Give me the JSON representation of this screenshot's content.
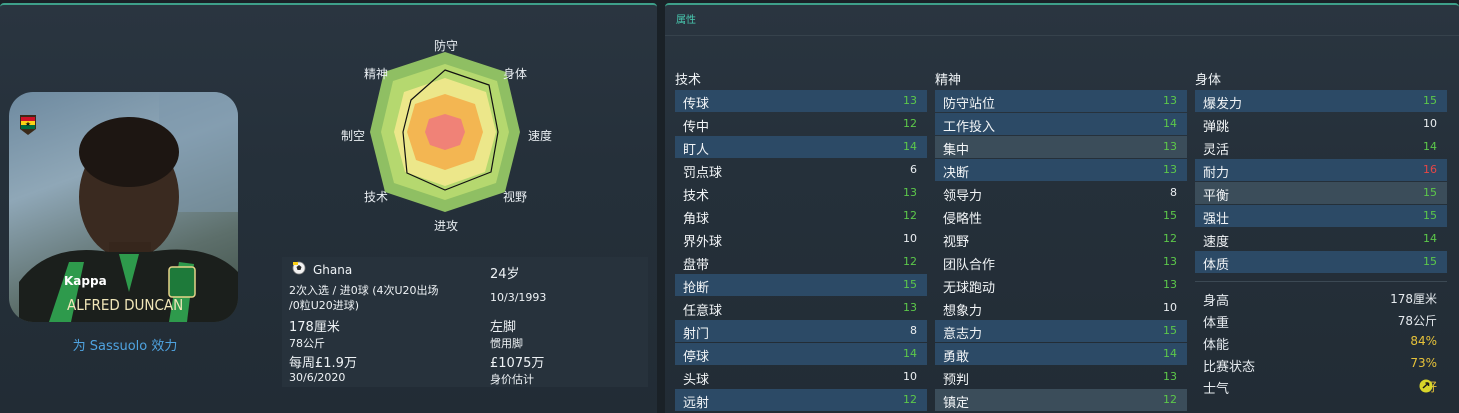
{
  "left": {
    "club_line": "为 Sassuolo 效力",
    "portrait_caption": "ALFRED DUNCAN",
    "kit_sponsor": "Kappa",
    "radar_labels": [
      "防守",
      "身体",
      "速度",
      "视野",
      "进攻",
      "技术",
      "制空",
      "精神"
    ],
    "nation": "Ghana",
    "caps": "2次入选 / 进0球 (4次U20出场",
    "caps2": "/0粒U20进球)",
    "age": "24岁",
    "dob": "10/3/1993",
    "height": "178厘米",
    "weight": "78公斤",
    "foot": "左脚",
    "foot_label": "惯用脚",
    "wage": "每周£1.9万",
    "contract": "30/6/2020",
    "value": "£1075万",
    "value_label": "身价估计"
  },
  "right": {
    "tab_title": "属性",
    "tech_title": "技术",
    "mental_title": "精神",
    "phys_title": "身体",
    "technical": [
      {
        "name": "传球",
        "value": "13"
      },
      {
        "name": "传中",
        "value": "12"
      },
      {
        "name": "盯人",
        "value": "14"
      },
      {
        "name": "罚点球",
        "value": "6"
      },
      {
        "name": "技术",
        "value": "13"
      },
      {
        "name": "角球",
        "value": "12"
      },
      {
        "name": "界外球",
        "value": "10"
      },
      {
        "name": "盘带",
        "value": "12"
      },
      {
        "name": "抢断",
        "value": "15"
      },
      {
        "name": "任意球",
        "value": "13"
      },
      {
        "name": "射门",
        "value": "8"
      },
      {
        "name": "停球",
        "value": "14"
      },
      {
        "name": "头球",
        "value": "10"
      },
      {
        "name": "远射",
        "value": "12"
      }
    ],
    "mental": [
      {
        "name": "防守站位",
        "value": "13"
      },
      {
        "name": "工作投入",
        "value": "14"
      },
      {
        "name": "集中",
        "value": "13"
      },
      {
        "name": "决断",
        "value": "13"
      },
      {
        "name": "领导力",
        "value": "8"
      },
      {
        "name": "侵略性",
        "value": "15"
      },
      {
        "name": "视野",
        "value": "12"
      },
      {
        "name": "团队合作",
        "value": "13"
      },
      {
        "name": "无球跑动",
        "value": "13"
      },
      {
        "name": "想象力",
        "value": "10"
      },
      {
        "name": "意志力",
        "value": "15"
      },
      {
        "name": "勇敢",
        "value": "14"
      },
      {
        "name": "预判",
        "value": "13"
      },
      {
        "name": "镇定",
        "value": "12"
      }
    ],
    "physical": [
      {
        "name": "爆发力",
        "value": "15"
      },
      {
        "name": "弹跳",
        "value": "10"
      },
      {
        "name": "灵活",
        "value": "14"
      },
      {
        "name": "耐力",
        "value": "16"
      },
      {
        "name": "平衡",
        "value": "15"
      },
      {
        "name": "强壮",
        "value": "15"
      },
      {
        "name": "速度",
        "value": "14"
      },
      {
        "name": "体质",
        "value": "15"
      }
    ],
    "bio": [
      {
        "name": "身高",
        "value": "178厘米"
      },
      {
        "name": "体重",
        "value": "78公斤"
      },
      {
        "name": "体能",
        "value": "84%"
      },
      {
        "name": "比赛状态",
        "value": "73%"
      },
      {
        "name": "士气",
        "value": "好"
      }
    ]
  }
}
